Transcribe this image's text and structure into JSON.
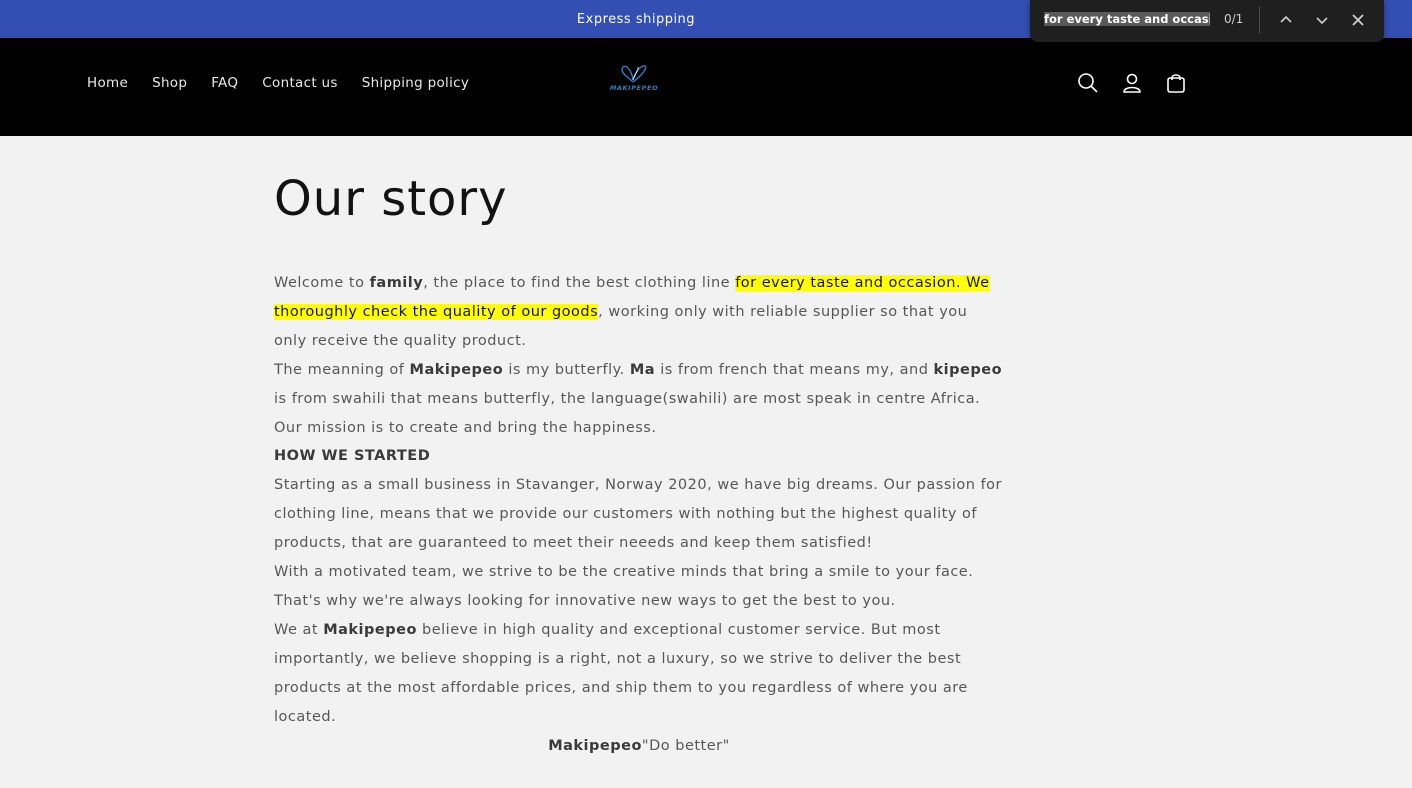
{
  "announcement": {
    "text": "Express shipping"
  },
  "nav": {
    "items": [
      "Home",
      "Shop",
      "FAQ",
      "Contact us",
      "Shipping policy"
    ]
  },
  "logo": {
    "text": "MAKIPEPEO"
  },
  "header_icons": [
    "search-icon",
    "account-icon",
    "cart-icon"
  ],
  "find_bar": {
    "query": "for every taste and occasion. W",
    "count": "0/1"
  },
  "page": {
    "title": "Our story",
    "p1": {
      "a": "Welcome to ",
      "b": "family",
      "c": ", the place to find the best clothing line ",
      "hl1": "for every taste and occasion. We",
      "d": " ",
      "hl2": "thoroughly check the quality of our goods",
      "e": ", working only with reliable supplier so that you only receive the quality product."
    },
    "p2": {
      "a": "The meanning of ",
      "b": "Makipepeo",
      "c": " is my butterfly. ",
      "d": "Ma",
      "e": " is from french that means my, and ",
      "f": "kipepeo",
      "g": " is from swahili that means butterfly, the language(swahili) are most speak in centre Africa."
    },
    "p3": "Our mission is to create and bring the happiness.",
    "p4": "HOW WE STARTED",
    "p5": "Starting as a small business in Stavanger, Norway 2020, we have big dreams. Our passion for clothing line, means that we provide our customers with nothing but the highest quality of products, that are guaranteed to meet their neeeds and keep them satisfied!",
    "p6": "With a motivated team, we strive to be the creative minds that bring a smile to your face. That's why we're always looking for innovative new ways to get the best to you.",
    "p7": {
      "a": "We at ",
      "b": "Makipepeo",
      "c": " believe in high quality and exceptional customer service. But most importantly, we believe shopping is a right, not a luxury, so we strive to deliver the best products at the most affordable prices, and ship them to you regardless of where you are located."
    },
    "p8": {
      "a": "Makipepeo",
      "b": "\"Do better\""
    }
  },
  "colors": {
    "announcement_bg": "#334fb4",
    "header_bg": "#000000",
    "page_bg": "#f2f2f2",
    "highlight": "#ffff00",
    "logo": "#2d7fc4"
  }
}
